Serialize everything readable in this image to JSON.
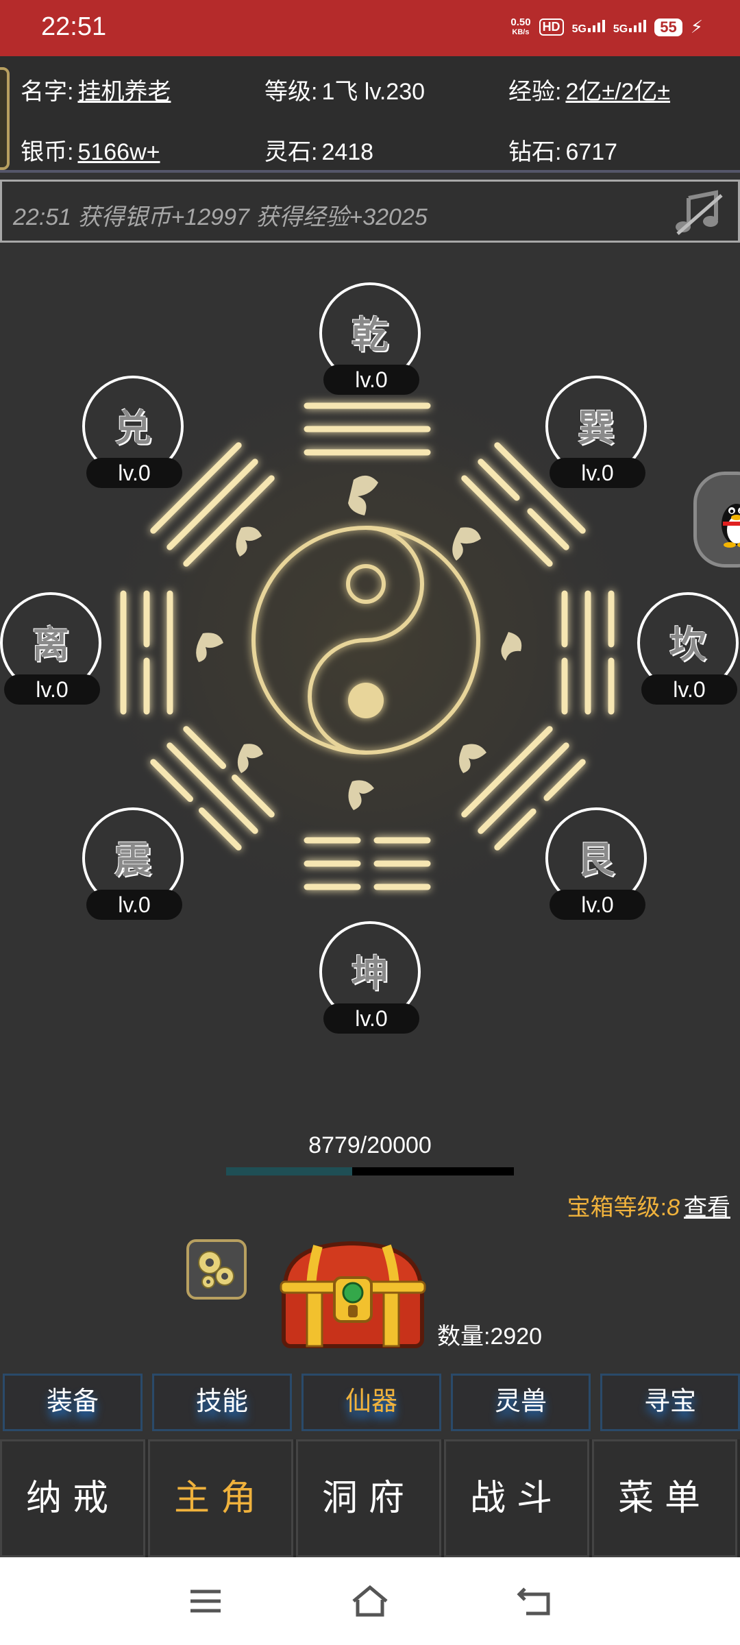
{
  "status_bar": {
    "time": "22:51",
    "net_speed_value": "0.50",
    "net_speed_unit": "KB/s",
    "hd_label": "HD",
    "sim1_label": "5G",
    "sim2_label": "5G",
    "battery": "55"
  },
  "header": {
    "name_label": "名字:",
    "name_value": "挂机养老",
    "level_label": "等级:",
    "level_value": "1飞 lv.230",
    "exp_label": "经验:",
    "exp_value": "2亿±/2亿±",
    "silver_label": "银币:",
    "silver_value": "5166w+",
    "spirit_label": "灵石:",
    "spirit_value": "2418",
    "diamond_label": "钻石:",
    "diamond_value": "6717"
  },
  "log": {
    "message": "22:51 获得银币+12997 获得经验+32025",
    "music_icon": "music-muted-icon"
  },
  "bagua": {
    "nodes": [
      {
        "glyph": "乾",
        "level": "lv.0",
        "state": "red"
      },
      {
        "glyph": "巽",
        "level": "lv.0",
        "state": "red"
      },
      {
        "glyph": "坎",
        "level": "lv.0",
        "state": "orange"
      },
      {
        "glyph": "艮",
        "level": "lv.0",
        "state": "red"
      },
      {
        "glyph": "坤",
        "level": "lv.0",
        "state": "red"
      },
      {
        "glyph": "震",
        "level": "lv.0",
        "state": "orange"
      },
      {
        "glyph": "离",
        "level": "lv.0",
        "state": "red"
      },
      {
        "glyph": "兑",
        "level": "lv.0",
        "state": "orange"
      }
    ],
    "colors": {
      "red": "#ee0000",
      "orange": "#f8a64e",
      "glow": "#f2dfa0"
    }
  },
  "progress": {
    "text": "8779/20000",
    "fraction": 0.439
  },
  "chest": {
    "level_label": "宝箱等级:",
    "level_value": "8",
    "view_label": "查看",
    "count_label": "数量:2920"
  },
  "sub_tabs": [
    {
      "label": "装备",
      "active": false
    },
    {
      "label": "技能",
      "active": false
    },
    {
      "label": "仙器",
      "active": true
    },
    {
      "label": "灵兽",
      "active": false
    },
    {
      "label": "寻宝",
      "active": false
    }
  ],
  "main_nav": [
    {
      "label": "纳戒",
      "active": false
    },
    {
      "label": "主角",
      "active": true
    },
    {
      "label": "洞府",
      "active": false
    },
    {
      "label": "战斗",
      "active": false
    },
    {
      "label": "菜单",
      "active": false
    }
  ],
  "accent_color": "#f0b23c"
}
